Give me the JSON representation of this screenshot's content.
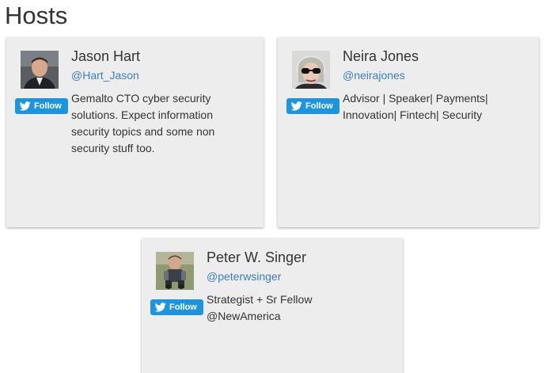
{
  "page": {
    "title": "Hosts"
  },
  "colors": {
    "card_background": "#ededed",
    "follow_button": "#1b95e0",
    "handle_link": "#3b7fbf",
    "text": "#333333"
  },
  "hosts": [
    {
      "name": "Jason Hart",
      "handle": "@Hart_Jason",
      "bio": "Gemalto CTO cyber security solutions. Expect information security topics and some non security stuff too.",
      "follow_label": "Follow",
      "follow_icon": "twitter-bird-icon"
    },
    {
      "name": "Neira Jones",
      "handle": "@neirajones",
      "bio": "Advisor | Speaker| Payments| Innovation| Fintech| Security",
      "follow_label": "Follow",
      "follow_icon": "twitter-bird-icon"
    },
    {
      "name": "Peter W. Singer",
      "handle": "@peterwsinger",
      "bio": "Strategist + Sr Fellow @NewAmerica",
      "follow_label": "Follow",
      "follow_icon": "twitter-bird-icon"
    }
  ]
}
